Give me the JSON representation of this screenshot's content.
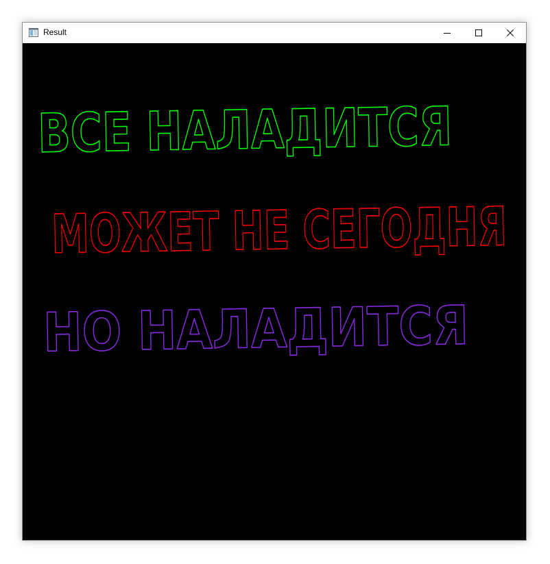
{
  "window": {
    "title": "Result"
  },
  "controls": {
    "minimize_icon": "minimize-icon",
    "maximize_icon": "maximize-icon",
    "close_icon": "close-icon"
  },
  "canvas": {
    "background": "#000000",
    "lines": [
      {
        "text": "ВСЕ НАЛАДИТСЯ",
        "color": "#00ff00"
      },
      {
        "text": "МОЖЕТ НЕ СЕГОДНЯ",
        "color": "#ff0000"
      },
      {
        "text": "НО НАЛАДИТСЯ",
        "color": "#8a2be2"
      }
    ]
  }
}
